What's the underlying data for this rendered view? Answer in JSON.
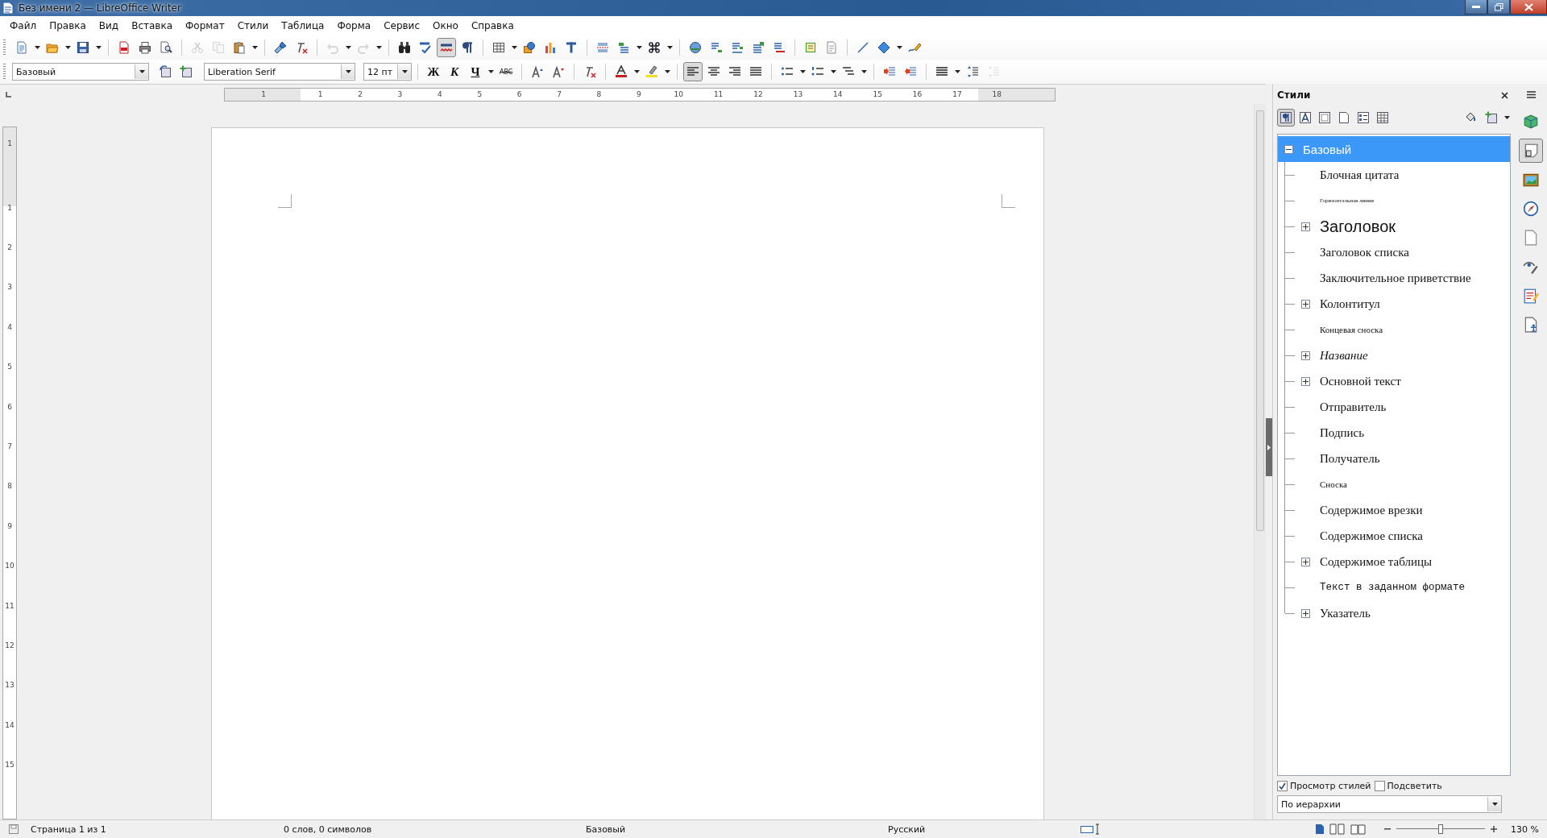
{
  "window": {
    "title": "Без имени 2 — LibreOffice Writer"
  },
  "menu": [
    "Файл",
    "Правка",
    "Вид",
    "Вставка",
    "Формат",
    "Стили",
    "Таблица",
    "Форма",
    "Сервис",
    "Окно",
    "Справка"
  ],
  "standard_toolbar": [
    {
      "kind": "new",
      "dropdown": true
    },
    {
      "kind": "open",
      "dropdown": true
    },
    {
      "kind": "save",
      "dropdown": true
    },
    {
      "kind": "sep"
    },
    {
      "kind": "pdf"
    },
    {
      "kind": "print"
    },
    {
      "kind": "preview"
    },
    {
      "kind": "sep"
    },
    {
      "kind": "cut",
      "disabled": true
    },
    {
      "kind": "copy",
      "disabled": true
    },
    {
      "kind": "paste",
      "dropdown": true
    },
    {
      "kind": "sep"
    },
    {
      "kind": "brush"
    },
    {
      "kind": "clear"
    },
    {
      "kind": "sep"
    },
    {
      "kind": "undo",
      "dropdown": true,
      "disabled": true
    },
    {
      "kind": "redo",
      "dropdown": true,
      "disabled": true
    },
    {
      "kind": "sep"
    },
    {
      "kind": "find"
    },
    {
      "kind": "spell"
    },
    {
      "kind": "autospell",
      "pressed": true
    },
    {
      "kind": "pilcrow"
    },
    {
      "kind": "sep"
    },
    {
      "kind": "table",
      "dropdown": true
    },
    {
      "kind": "image"
    },
    {
      "kind": "chart"
    },
    {
      "kind": "textbox"
    },
    {
      "kind": "sep"
    },
    {
      "kind": "pagebreak"
    },
    {
      "kind": "field",
      "dropdown": true
    },
    {
      "kind": "special",
      "dropdown": true
    },
    {
      "kind": "sep"
    },
    {
      "kind": "link"
    },
    {
      "kind": "footnote"
    },
    {
      "kind": "endnote"
    },
    {
      "kind": "bookmark"
    },
    {
      "kind": "crossref"
    },
    {
      "kind": "sep"
    },
    {
      "kind": "comment"
    },
    {
      "kind": "track"
    },
    {
      "kind": "sep"
    },
    {
      "kind": "line"
    },
    {
      "kind": "shape",
      "dropdown": true
    },
    {
      "kind": "draw"
    }
  ],
  "formatting_toolbar": {
    "paragraph_style": "Базовый",
    "font_name": "Liberation Serif",
    "font_size": "12 пт",
    "text_buttons": [
      {
        "label": "Ж",
        "kind": "bold"
      },
      {
        "label": "К",
        "kind": "italic"
      },
      {
        "label": "Ч",
        "kind": "underline",
        "dropdown": true
      },
      {
        "label": "ABC",
        "kind": "strike"
      }
    ],
    "tools": [
      {
        "kind": "grow"
      },
      {
        "kind": "shrink"
      },
      {
        "kind": "sep"
      },
      {
        "kind": "clear"
      },
      {
        "kind": "sep"
      },
      {
        "kind": "fontcolor",
        "dropdown": true
      },
      {
        "kind": "highlight",
        "dropdown": true
      },
      {
        "kind": "sep"
      },
      {
        "kind": "alignleft",
        "pressed": true
      },
      {
        "kind": "aligncenter"
      },
      {
        "kind": "alignright"
      },
      {
        "kind": "justify"
      },
      {
        "kind": "sep"
      },
      {
        "kind": "bullets",
        "dropdown": true
      },
      {
        "kind": "numbering",
        "dropdown": true
      },
      {
        "kind": "outline",
        "dropdown": true
      },
      {
        "kind": "sep"
      },
      {
        "kind": "indentmore"
      },
      {
        "kind": "indentless"
      },
      {
        "kind": "sep"
      },
      {
        "kind": "linespacing",
        "dropdown": true
      },
      {
        "kind": "paraspace"
      },
      {
        "kind": "paraspace2",
        "disabled": true
      }
    ]
  },
  "horizontal_ruler": [
    "1",
    "1",
    "2",
    "3",
    "4",
    "5",
    "6",
    "7",
    "8",
    "9",
    "10",
    "11",
    "12",
    "13",
    "14",
    "15",
    "16",
    "17",
    "18"
  ],
  "vertical_ruler": [
    "1",
    "1",
    "2",
    "3",
    "4",
    "5",
    "6",
    "7",
    "8",
    "9",
    "10",
    "11",
    "12",
    "13",
    "14",
    "15"
  ],
  "sidebar": {
    "title": "Стили",
    "categories": [
      {
        "selected": true
      },
      {
        "selected": false
      },
      {
        "selected": false
      },
      {
        "selected": false
      },
      {
        "selected": false
      },
      {
        "selected": false
      }
    ],
    "styles": [
      {
        "name": "Базовый",
        "kind": "root",
        "selected": true,
        "expanded": true,
        "children": [
          {
            "name": "Блочная цитата",
            "kind": "normal",
            "selected": false
          },
          {
            "name": "Горизонтальная линия",
            "kind": "tiny",
            "selected": false
          },
          {
            "name": "Заголовок",
            "kind": "heading",
            "selected": false,
            "expanded": false
          },
          {
            "name": "Заголовок списка",
            "kind": "normal",
            "selected": false
          },
          {
            "name": "Заключительное приветствие",
            "kind": "normal",
            "selected": false
          },
          {
            "name": "Колонтитул",
            "kind": "normal",
            "selected": false,
            "expanded": false
          },
          {
            "name": "Концевая сноска",
            "kind": "small",
            "selected": false
          },
          {
            "name": "Название",
            "kind": "italic",
            "selected": false,
            "expanded": false
          },
          {
            "name": "Основной текст",
            "kind": "normal",
            "selected": false,
            "expanded": false
          },
          {
            "name": "Отправитель",
            "kind": "normal",
            "selected": false
          },
          {
            "name": "Подпись",
            "kind": "normal",
            "selected": false
          },
          {
            "name": "Получатель",
            "kind": "normal",
            "selected": false
          },
          {
            "name": "Сноска",
            "kind": "small",
            "selected": false
          },
          {
            "name": "Содержимое врезки",
            "kind": "normal",
            "selected": false
          },
          {
            "name": "Содержимое списка",
            "kind": "normal",
            "selected": false
          },
          {
            "name": "Содержимое таблицы",
            "kind": "normal",
            "selected": false,
            "expanded": false
          },
          {
            "name": "Текст в заданном формате",
            "kind": "mono",
            "selected": false
          },
          {
            "name": "Указатель",
            "kind": "normal",
            "selected": false,
            "expanded": false
          }
        ]
      }
    ],
    "preview_styles": {
      "label": "Просмотр стилей",
      "checked": true
    },
    "highlight": {
      "label": "Подсветить",
      "checked": false
    },
    "filter": "По иерархии",
    "deck": [
      {
        "kind": "styles",
        "selected": true
      },
      {
        "kind": "gallery",
        "selected": false
      },
      {
        "kind": "navigator",
        "selected": false
      },
      {
        "kind": "page",
        "selected": false
      },
      {
        "kind": "inspector",
        "selected": false
      },
      {
        "kind": "manage",
        "selected": false
      },
      {
        "kind": "accessibility",
        "selected": false
      }
    ]
  },
  "status_bar": {
    "page": "Страница 1 из 1",
    "words": "0 слов, 0 символов",
    "style": "Базовый",
    "language": "Русский",
    "zoom": "130 %",
    "zoom_slider": {
      "level": 0.5
    }
  }
}
